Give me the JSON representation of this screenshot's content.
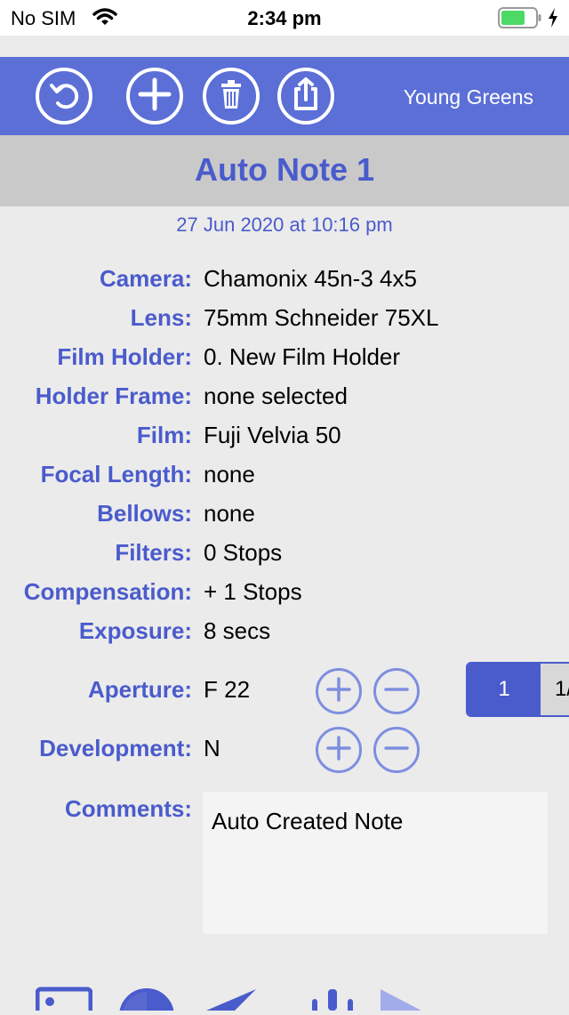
{
  "status": {
    "carrier": "No SIM",
    "time": "2:34 pm"
  },
  "toolbar": {
    "title": "Young Greens",
    "buttons": [
      {
        "name": "undo-icon"
      },
      {
        "name": "plus-icon"
      },
      {
        "name": "trash-icon"
      },
      {
        "name": "share-icon"
      }
    ]
  },
  "note": {
    "title": "Auto Note 1",
    "timestamp": "27 Jun 2020 at 10:16 pm"
  },
  "fields": [
    {
      "label": "Camera:",
      "value": "Chamonix 45n-3 4x5"
    },
    {
      "label": "Lens:",
      "value": "75mm Schneider 75XL"
    },
    {
      "label": "Film Holder:",
      "value": "0. New Film Holder"
    },
    {
      "label": "Holder Frame:",
      "value": "none selected"
    },
    {
      "label": "Film:",
      "value": "Fuji Velvia 50"
    },
    {
      "label": "Focal Length:",
      "value": "none"
    },
    {
      "label": "Bellows:",
      "value": "none"
    },
    {
      "label": "Filters:",
      "value": "0 Stops"
    },
    {
      "label": "Compensation:",
      "value": "+ 1 Stops"
    },
    {
      "label": "Exposure:",
      "value": "8 secs"
    }
  ],
  "aperture": {
    "label": "Aperture:",
    "value": "F 22",
    "segment": [
      "1",
      "1/"
    ]
  },
  "development": {
    "label": "Development:",
    "value": "N"
  },
  "comments": {
    "label": "Comments:",
    "text": "Auto Created Note"
  },
  "colors": {
    "accent": "#4a5bcc",
    "toolbar": "#5b6fd6",
    "title_bar": "#c9c9c9",
    "background": "#ebebeb"
  }
}
